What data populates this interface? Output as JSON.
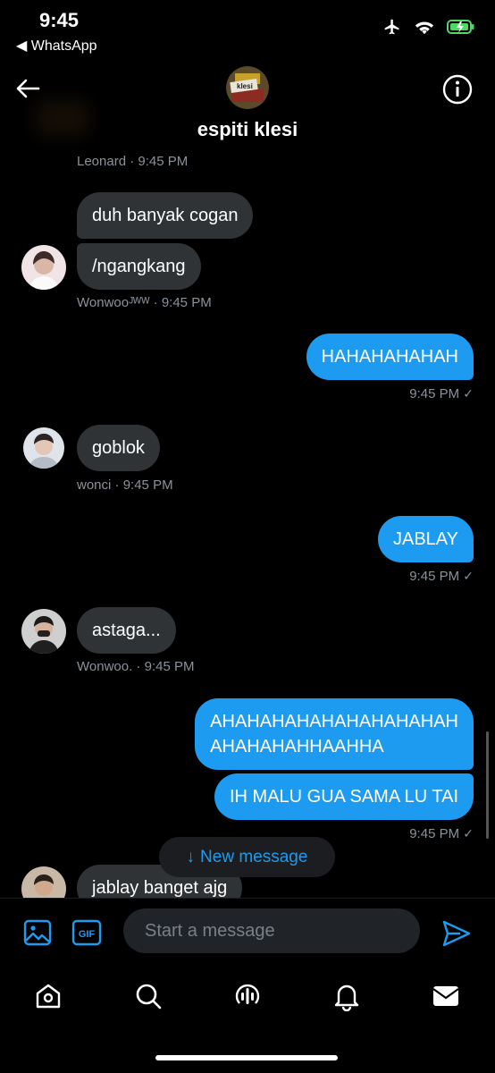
{
  "status": {
    "time": "9:45",
    "back_app": "◀ WhatsApp"
  },
  "header": {
    "title": "espiti klesi",
    "avatar_text": "klesi"
  },
  "messages": [
    {
      "sender": "Leonard",
      "time": "9:45 PM"
    },
    {
      "text": "duh banyak cogan"
    },
    {
      "text": "/ngangkang",
      "sender": "Wonwooᴶᵂᵂ",
      "time": "9:45 PM"
    },
    {
      "text": "HAHAHAHAHAH",
      "time": "9:45 PM"
    },
    {
      "text": "goblok",
      "sender": "wonci",
      "time": "9:45 PM"
    },
    {
      "text": "JABLAY",
      "time": "9:45 PM"
    },
    {
      "text": "astaga...",
      "sender": "Wonwoo.",
      "time": "9:45 PM"
    },
    {
      "text_line1": "AHAHAHAHAHAHAHAHAHAH",
      "text_line2": "AHAHAHAHHAAHHA"
    },
    {
      "text": "IH MALU GUA SAMA LU TAI",
      "time": "9:45 PM"
    },
    {
      "text": "jablay banget ajg"
    }
  ],
  "new_message_label": "New message",
  "composer": {
    "placeholder": "Start a message",
    "gif_label": "GIF"
  },
  "colors": {
    "accent": "#1d9bf0",
    "incoming_bubble": "#2f3336",
    "background": "#000000",
    "meta_text": "#8b9299"
  }
}
